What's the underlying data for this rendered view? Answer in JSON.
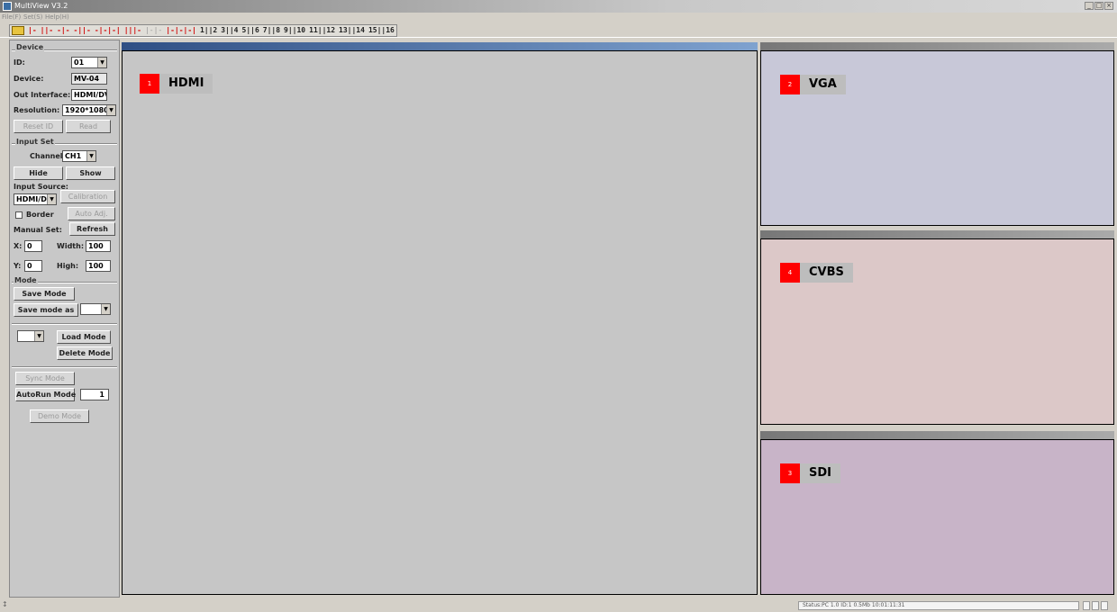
{
  "window": {
    "title": "MultiView V3.2"
  },
  "menu": [
    "File(F)",
    "Set(S)",
    "Help(H)"
  ],
  "toolbar": [
    "|-",
    "||-",
    "-|-",
    "-||-",
    "-|-|-|",
    "|||-",
    "|-|-",
    "|-|-|-|",
    "1||2",
    "3||4",
    "5||6",
    "7||8",
    "9||10",
    "11||12",
    "13||14",
    "15||16"
  ],
  "sidebar": {
    "device": {
      "title": "Device",
      "id_label": "ID:",
      "id_value": "01",
      "device_label": "Device:",
      "device_value": "MV-04",
      "out_label": "Out Interface:",
      "out_value": "HDMI/DVI",
      "res_label": "Resolution:",
      "res_value": "1920*1080",
      "reset_id": "Reset ID",
      "read": "Read"
    },
    "input": {
      "title": "Input Set",
      "channel_label": "Channel:",
      "channel_value": "CH1",
      "hide": "Hide",
      "show": "Show",
      "source_label": "Input Source:",
      "source_value": "HDMI/DVI",
      "calibration": "Calibration",
      "border_label": "Border",
      "auto_adj": "Auto Adj.",
      "manual_label": "Manual Set:",
      "refresh": "Refresh",
      "x_label": "X:",
      "x_value": "0",
      "width_label": "Width:",
      "width_value": "100",
      "y_label": "Y:",
      "y_value": "0",
      "high_label": "High:",
      "high_value": "100"
    },
    "mode": {
      "title": "Mode",
      "save_mode": "Save Mode",
      "save_mode_as": "Save mode as",
      "load_mode": "Load Mode",
      "delete_mode": "Delete Mode",
      "sync_mode": "Sync Mode",
      "autorun_mode": "AutoRun Mode",
      "autorun_value": "1",
      "demo_mode": "Demo Mode"
    }
  },
  "panels": [
    {
      "num": "1",
      "name": "HDMI",
      "bg": "#c6c6c6",
      "hdr": "#2f4f84"
    },
    {
      "num": "2",
      "name": "VGA",
      "bg": "#c8c8d8",
      "hdr": "#8a8a8a"
    },
    {
      "num": "4",
      "name": "CVBS",
      "bg": "#dcc8c8",
      "hdr": "#8a8a8a"
    },
    {
      "num": "3",
      "name": "SDI",
      "bg": "#c8b4c8",
      "hdr": "#8a8a8a"
    }
  ],
  "status": {
    "info": "Status:PC 1.0   ID:1   0.5Mb  10:01:11:31"
  },
  "colors": {
    "badge": "#ff0000",
    "tag_bg": "#bdbdbd"
  }
}
